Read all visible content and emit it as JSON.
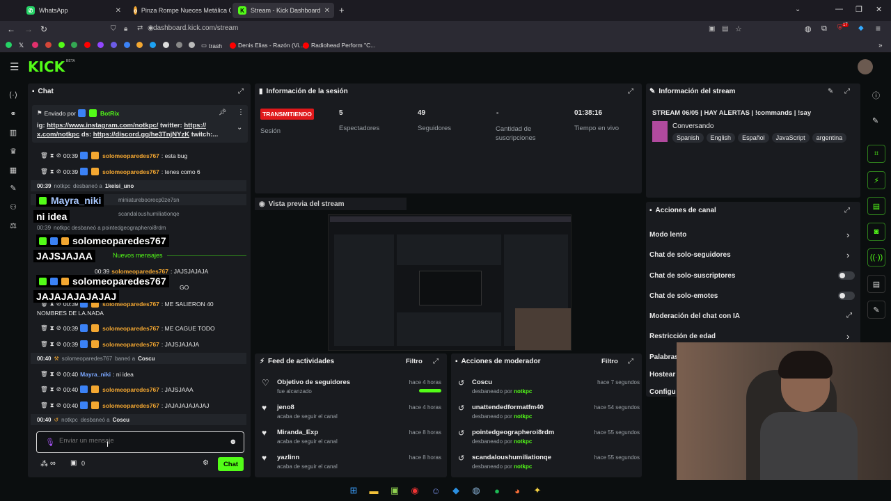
{
  "browser": {
    "tabs": [
      {
        "title": "WhatsApp",
        "color": "#25d366",
        "icon": "whatsapp-icon"
      },
      {
        "title": "Pinza Rompe Nueces Metálica C",
        "color": "#f3a731",
        "icon": "product-icon"
      },
      {
        "title": "Stream - Kick Dashboard",
        "color": "#53fc18",
        "icon": "kick-icon"
      }
    ],
    "new_tab": "+",
    "url": "dashboard.kick.com/stream",
    "bookmarks": [
      "trash",
      "Denis Elias - Razón (Vi...",
      "Radiohead Perform \"C..."
    ],
    "notification_count": "17"
  },
  "kick": {
    "logo": "KICK",
    "logo_sup": "BETA"
  },
  "chat": {
    "title": "Chat",
    "pinned_label": "Enviado por",
    "pinned_user": "BotRix",
    "pinned_text1_prefix": "ig: ",
    "pinned_link1": "https://www.instagram.com/notkpc/",
    "pinned_text1_mid": " twitter: ",
    "pinned_link2": "https://",
    "pinned_link3": "x.com/notkpc",
    "pinned_text2_mid": " ds: ",
    "pinned_link4": "https://discord.gg/he3TnjNYzK",
    "pinned_text2_end": " twitch:...",
    "messages": [
      {
        "time": "00:39",
        "user": "solomeoparedes767",
        "text": ": esta bug"
      },
      {
        "time": "00:39",
        "user": "solomeoparedes767",
        "text": ": tenes como 6"
      }
    ],
    "sys1_time": "00:39",
    "sys1_user": "notkpc",
    "sys1_action": "desbaneó a",
    "sys1_target": "1keisi_uno",
    "sys2_text": "miniatureboorecp0ze7sn",
    "sys3_text": "scandaloushumiliationqe",
    "sys4_time": "00:39",
    "sys4_text": "notkpc desbaneó a pointedgeographeroi8rdm",
    "nuevos": "Nuevos mensajes",
    "m_a_time": "00:39",
    "m_a_user": "solomeoparedes767",
    "m_a_text": ": JAJSJAJAJA",
    "m_b_text": "GO",
    "m_c_time": "00:39",
    "m_c_user": "solomeoparedes767",
    "m_c_text": ": ME SALIERON 40",
    "m_c_text2": "NOMBRES DE LA.NADA",
    "m_d_time": "00:39",
    "m_d_user": "solomeoparedes767",
    "m_d_text": ": ME CAGUE TODO",
    "m_e_time": "00:39",
    "m_e_user": "solomeoparedes767",
    "m_e_text": ": JAJSJAJAJA",
    "ban_time": "00:40",
    "ban_user": "solomeoparedes767",
    "ban_action": "baneó a",
    "ban_target": "Coscu",
    "m_f_time": "00:40",
    "m_f_user": "Mayra_niki",
    "m_f_text": ": ni idea",
    "m_g_time": "00:40",
    "m_g_user": "solomeoparedes767",
    "m_g_text": ": JAJSJAAA",
    "m_h_time": "00:40",
    "m_h_user": "solomeoparedes767",
    "m_h_text": ": JAJAJAJAJAJAJ",
    "unban_time": "00:40",
    "unban_user": "notkpc",
    "unban_action": "desbaneó a",
    "unban_target": "Coscu",
    "input_placeholder": "Enviar un mensaje",
    "points": "0",
    "send_label": "Chat"
  },
  "overlay": {
    "o1_user": "Mayra_niki",
    "o1_text": "ni idea",
    "o2_user": "solomeoparedes767",
    "o2_text": "JAJSJAJAA",
    "o3_user": "solomeoparedes767",
    "o3_text": "JAJAJAJAJAJAJ"
  },
  "session": {
    "title": "Información de la sesión",
    "live_badge": "TRANSMITIENDO",
    "session_label": "Sesión",
    "viewers": "5",
    "viewers_label": "Espectadores",
    "followers": "49",
    "followers_label": "Seguidores",
    "subs": "-",
    "subs_label": "Cantidad de suscripciones",
    "uptime": "01:38:16",
    "uptime_label": "Tiempo en vivo"
  },
  "stream_info": {
    "title": "Información del stream",
    "stream_title": "STREAM 06/05 | HAY ALERTAS | !commands | !say",
    "category": "Conversando",
    "tags": [
      "Spanish",
      "English",
      "Español",
      "JavaScript",
      "argentina"
    ]
  },
  "preview": {
    "title": "Vista previa del stream"
  },
  "channel_actions": {
    "title": "Acciones de canal",
    "items": [
      "Modo lento",
      "Chat de solo-seguidores",
      "Chat de solo-suscriptores",
      "Chat de solo-emotes",
      "Moderación del chat con IA",
      "Restricción de edad",
      "Palabras",
      "Hostear",
      "Configu"
    ]
  },
  "activity": {
    "title": "Feed de actividades",
    "filter": "Filtro",
    "items": [
      {
        "title": "Objetivo de seguidores",
        "sub": "fue alcanzado",
        "time": "hace 4 horas",
        "progress": 1.0
      },
      {
        "title": "jeno8",
        "sub": "acaba de seguir el canal",
        "time": "hace 4 horas"
      },
      {
        "title": "Miranda_Exp",
        "sub": "acaba de seguir el canal",
        "time": "hace 8 horas"
      },
      {
        "title": "yazlinn",
        "sub": "acaba de seguir el canal",
        "time": "hace 8 horas"
      }
    ]
  },
  "mod_actions": {
    "title": "Acciones de moderador",
    "filter": "Filtro",
    "by_label": "desbaneado por",
    "items": [
      {
        "user": "Coscu",
        "mod": "notkpc",
        "time": "hace 7 segundos"
      },
      {
        "user": "unattendedformatfm40",
        "mod": "notkpc",
        "time": "hace 54 segundos"
      },
      {
        "user": "pointedgeographeroi8rdm",
        "mod": "notkpc",
        "time": "hace 55 segundos"
      },
      {
        "user": "scandaloushumiliationqe",
        "mod": "notkpc",
        "time": "hace 55 segundos"
      }
    ]
  }
}
